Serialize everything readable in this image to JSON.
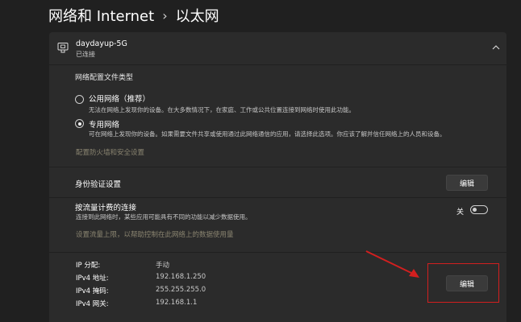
{
  "breadcrumb": {
    "parent": "网络和 Internet",
    "separator": "›",
    "current": "以太网"
  },
  "network": {
    "name": "daydayup-5G",
    "status": "已连接"
  },
  "profile": {
    "title": "网络配置文件类型",
    "public_label": "公用网络（推荐）",
    "public_desc": "无法在网络上发现你的设备。在大多数情况下，在家庭、工作或公共位置连接到网络时使用此功能。",
    "private_label": "专用网络",
    "private_desc": "可在网络上发现你的设备。如果需要文件共享或使用通过此网络通信的应用，请选择此选项。你应该了解并信任网络上的人员和设备。",
    "selected": "private",
    "firewall_link": "配置防火墙和安全设置"
  },
  "auth": {
    "title": "身份验证设置",
    "edit_label": "编辑"
  },
  "metered": {
    "title": "按流量计费的连接",
    "desc": "连接到此网络时，某些应用可能具有不同的功能以减少数据使用。",
    "toggle_label": "关",
    "toggle_on": false,
    "data_limit_link": "设置流量上限，以帮助控制在此网络上的数据使用量"
  },
  "ip": {
    "assign_label": "IP 分配:",
    "assign_value": "手动",
    "ipv4_label": "IPv4 地址:",
    "ipv4_value": "192.168.1.250",
    "mask_label": "IPv4 掩码:",
    "mask_value": "255.255.255.0",
    "gateway_label": "IPv4 网关:",
    "gateway_value": "192.168.1.1",
    "edit_label": "编辑"
  },
  "colors": {
    "annotation": "#d21f1f",
    "background": "#202020",
    "card": "#2b2b2b"
  }
}
